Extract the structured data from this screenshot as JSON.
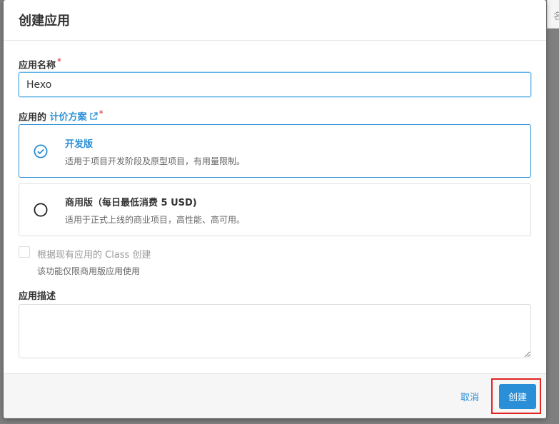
{
  "backdrop": {
    "partial_text": "名"
  },
  "modal": {
    "title": "创建应用",
    "name_field": {
      "label": "应用名称",
      "required_mark": "*",
      "value": "Hexo"
    },
    "pricing": {
      "label_prefix": "应用的",
      "link_text": "计价方案",
      "required_mark": "*",
      "options": [
        {
          "title": "开发版",
          "description": "适用于项目开发阶段及原型项目，有用量限制。",
          "selected": true
        },
        {
          "title": "商用版（每日最低消费 5 USD)",
          "description": "适用于正式上线的商业项目，高性能、高可用。",
          "selected": false
        }
      ]
    },
    "clone_option": {
      "label": "根据现有应用的 Class 创建",
      "hint": "该功能仅限商用版应用使用",
      "checked": false
    },
    "description_field": {
      "label": "应用描述",
      "value": ""
    },
    "footer": {
      "cancel_label": "取消",
      "create_label": "创建"
    }
  },
  "colors": {
    "accent": "#2a8fd6",
    "required": "#e02424",
    "highlight": "#e02424"
  }
}
